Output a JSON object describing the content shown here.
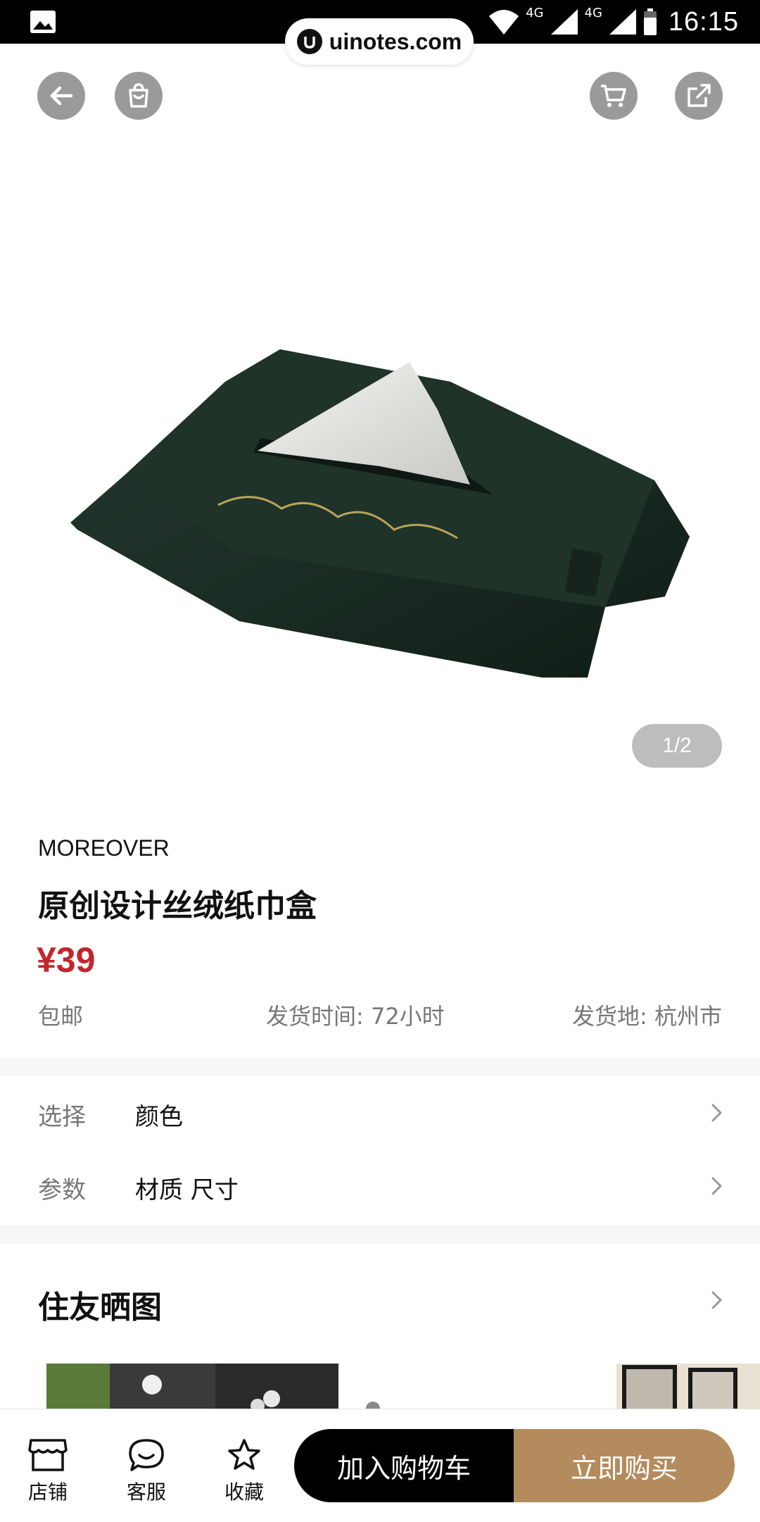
{
  "status_bar": {
    "time": "16:15",
    "network_1": "4G",
    "network_2": "4G"
  },
  "watermark": {
    "text": "uinotes.com"
  },
  "top_actions": {
    "back_icon": "arrow-left-icon",
    "store_icon": "shopping-bag-icon",
    "cart_icon": "cart-icon",
    "share_icon": "share-icon"
  },
  "gallery": {
    "counter": "1/2"
  },
  "product": {
    "brand": "MOREOVER",
    "title": "原创设计丝绒纸巾盒",
    "price": "¥39",
    "shipping": "包邮",
    "ship_time": "发货时间: 72小时",
    "ship_from": "发货地: 杭州市"
  },
  "options": [
    {
      "label": "选择",
      "value": "颜色"
    },
    {
      "label": "参数",
      "value": "材质 尺寸"
    }
  ],
  "reviews": {
    "title": "住友晒图"
  },
  "bottom_bar": {
    "tabs": [
      {
        "label": "店铺",
        "icon": "store-icon"
      },
      {
        "label": "客服",
        "icon": "chat-icon"
      },
      {
        "label": "收藏",
        "icon": "star-icon"
      }
    ],
    "add_to_cart": "加入购物车",
    "buy_now": "立即购买"
  },
  "colors": {
    "price": "#c0272d",
    "buy_button": "#b38b5d",
    "cart_button": "#000000"
  }
}
